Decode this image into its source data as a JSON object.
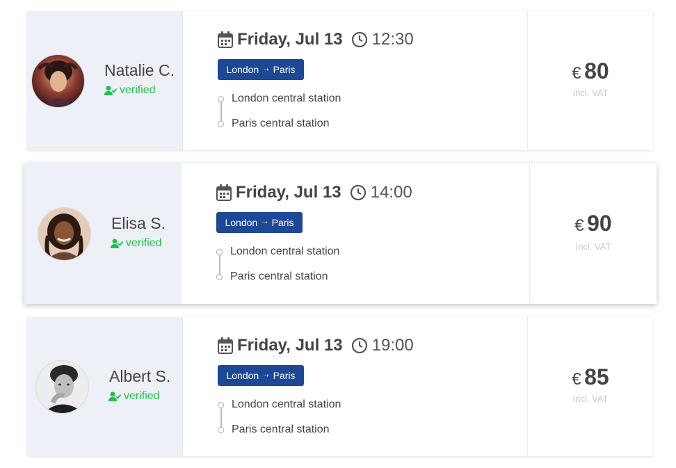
{
  "rides": [
    {
      "driver_name": "Natalie C.",
      "verified_label": "verified",
      "date": "Friday, Jul 13",
      "time": "12:30",
      "route_from": "London",
      "route_to": "Paris",
      "stop_from": "London central station",
      "stop_to": "Paris central station",
      "currency": "€",
      "price": "80",
      "vat_label": "Incl. VAT"
    },
    {
      "driver_name": "Elisa S.",
      "verified_label": "verified",
      "date": "Friday, Jul 13",
      "time": "14:00",
      "route_from": "London",
      "route_to": "Paris",
      "stop_from": "London central station",
      "stop_to": "Paris central station",
      "currency": "€",
      "price": "90",
      "vat_label": "Incl. VAT"
    },
    {
      "driver_name": "Albert S.",
      "verified_label": "verified",
      "date": "Friday, Jul 13",
      "time": "19:00",
      "route_from": "London",
      "route_to": "Paris",
      "stop_from": "London central station",
      "stop_to": "Paris central station",
      "currency": "€",
      "price": "85",
      "vat_label": "Incl. VAT"
    }
  ],
  "icons": {
    "calendar": "calendar-icon",
    "clock": "clock-icon",
    "verified": "user-check-icon",
    "route_arrow": "arrow-right-icon"
  },
  "colors": {
    "accent_blue": "#1c4896",
    "verified_green": "#21c04a",
    "driver_panel_bg": "#eef0f7"
  }
}
